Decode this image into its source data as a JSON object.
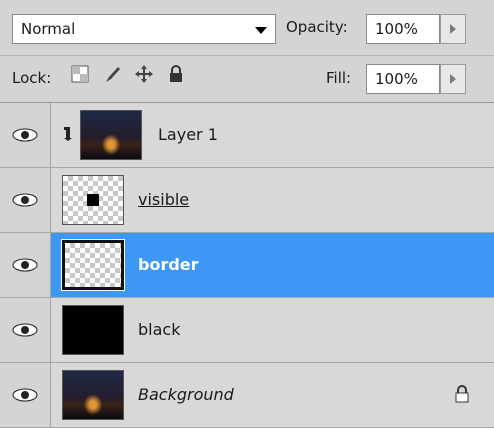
{
  "blend": {
    "mode": "Normal"
  },
  "opacity": {
    "label": "Opacity:",
    "value": "100%"
  },
  "lock": {
    "label": "Lock:",
    "icons": [
      "lock-transparent-icon",
      "lock-paint-icon",
      "lock-move-icon",
      "lock-all-icon"
    ]
  },
  "fill": {
    "label": "Fill:",
    "value": "100%"
  },
  "layers": [
    {
      "name": "Layer 1",
      "thumb": "photo",
      "clipped": true,
      "visible": true,
      "selected": false,
      "style": "normal"
    },
    {
      "name": "visible",
      "thumb": "checker-dot",
      "clipped": false,
      "visible": true,
      "selected": false,
      "style": "underline"
    },
    {
      "name": "border",
      "thumb": "checker-border",
      "clipped": false,
      "visible": true,
      "selected": true,
      "style": "bold"
    },
    {
      "name": "black",
      "thumb": "black",
      "clipped": false,
      "visible": true,
      "selected": false,
      "style": "normal"
    },
    {
      "name": "Background",
      "thumb": "photo",
      "clipped": false,
      "visible": true,
      "selected": false,
      "style": "italic",
      "locked": true
    }
  ],
  "colors": {
    "selection": "#3d97f5",
    "panel": "#d6d6d6"
  }
}
